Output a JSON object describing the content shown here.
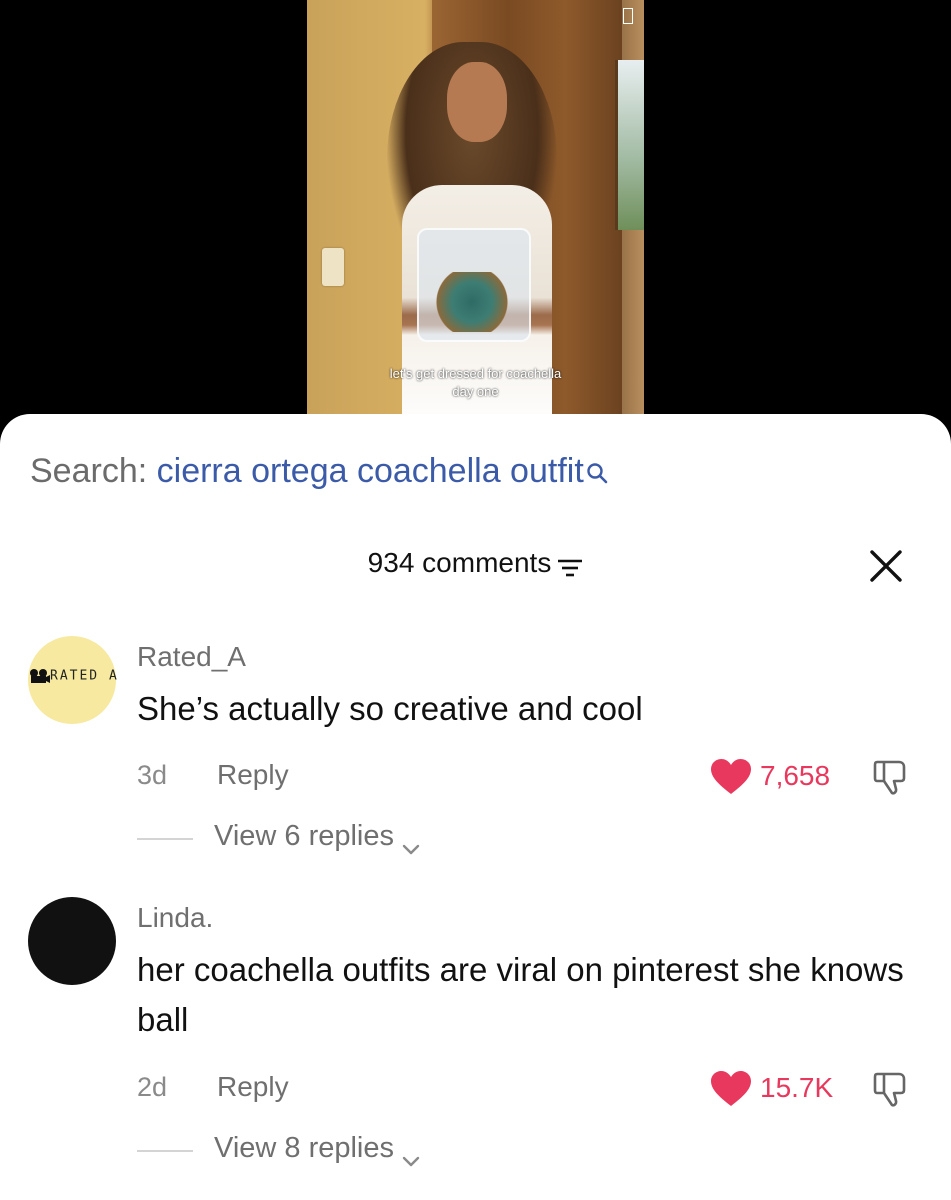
{
  "video": {
    "caption_line1": "let's get dressed for coachella",
    "caption_line2": "day one"
  },
  "search": {
    "prefix": "Search:",
    "query": "cierra ortega coachella outfit"
  },
  "comments_header": {
    "count_label": "934 comments"
  },
  "comments": [
    {
      "username": "Rated_A",
      "avatar_text": "RATED A",
      "text": "She’s actually so creative and cool",
      "time": "3d",
      "reply_label": "Reply",
      "likes": "7,658",
      "view_replies": "View 6 replies"
    },
    {
      "username": "Linda.",
      "text": "her coachella outfits are viral on pinterest she knows ball",
      "time": "2d",
      "reply_label": "Reply",
      "likes": "15.7K",
      "view_replies": "View 8 replies"
    }
  ],
  "colors": {
    "like": "#e8385d",
    "search_query": "#3b5ba9"
  },
  "icons": [
    "search-icon",
    "sort-icon",
    "close-icon",
    "heart-icon",
    "dislike-icon",
    "chevron-down-icon"
  ]
}
